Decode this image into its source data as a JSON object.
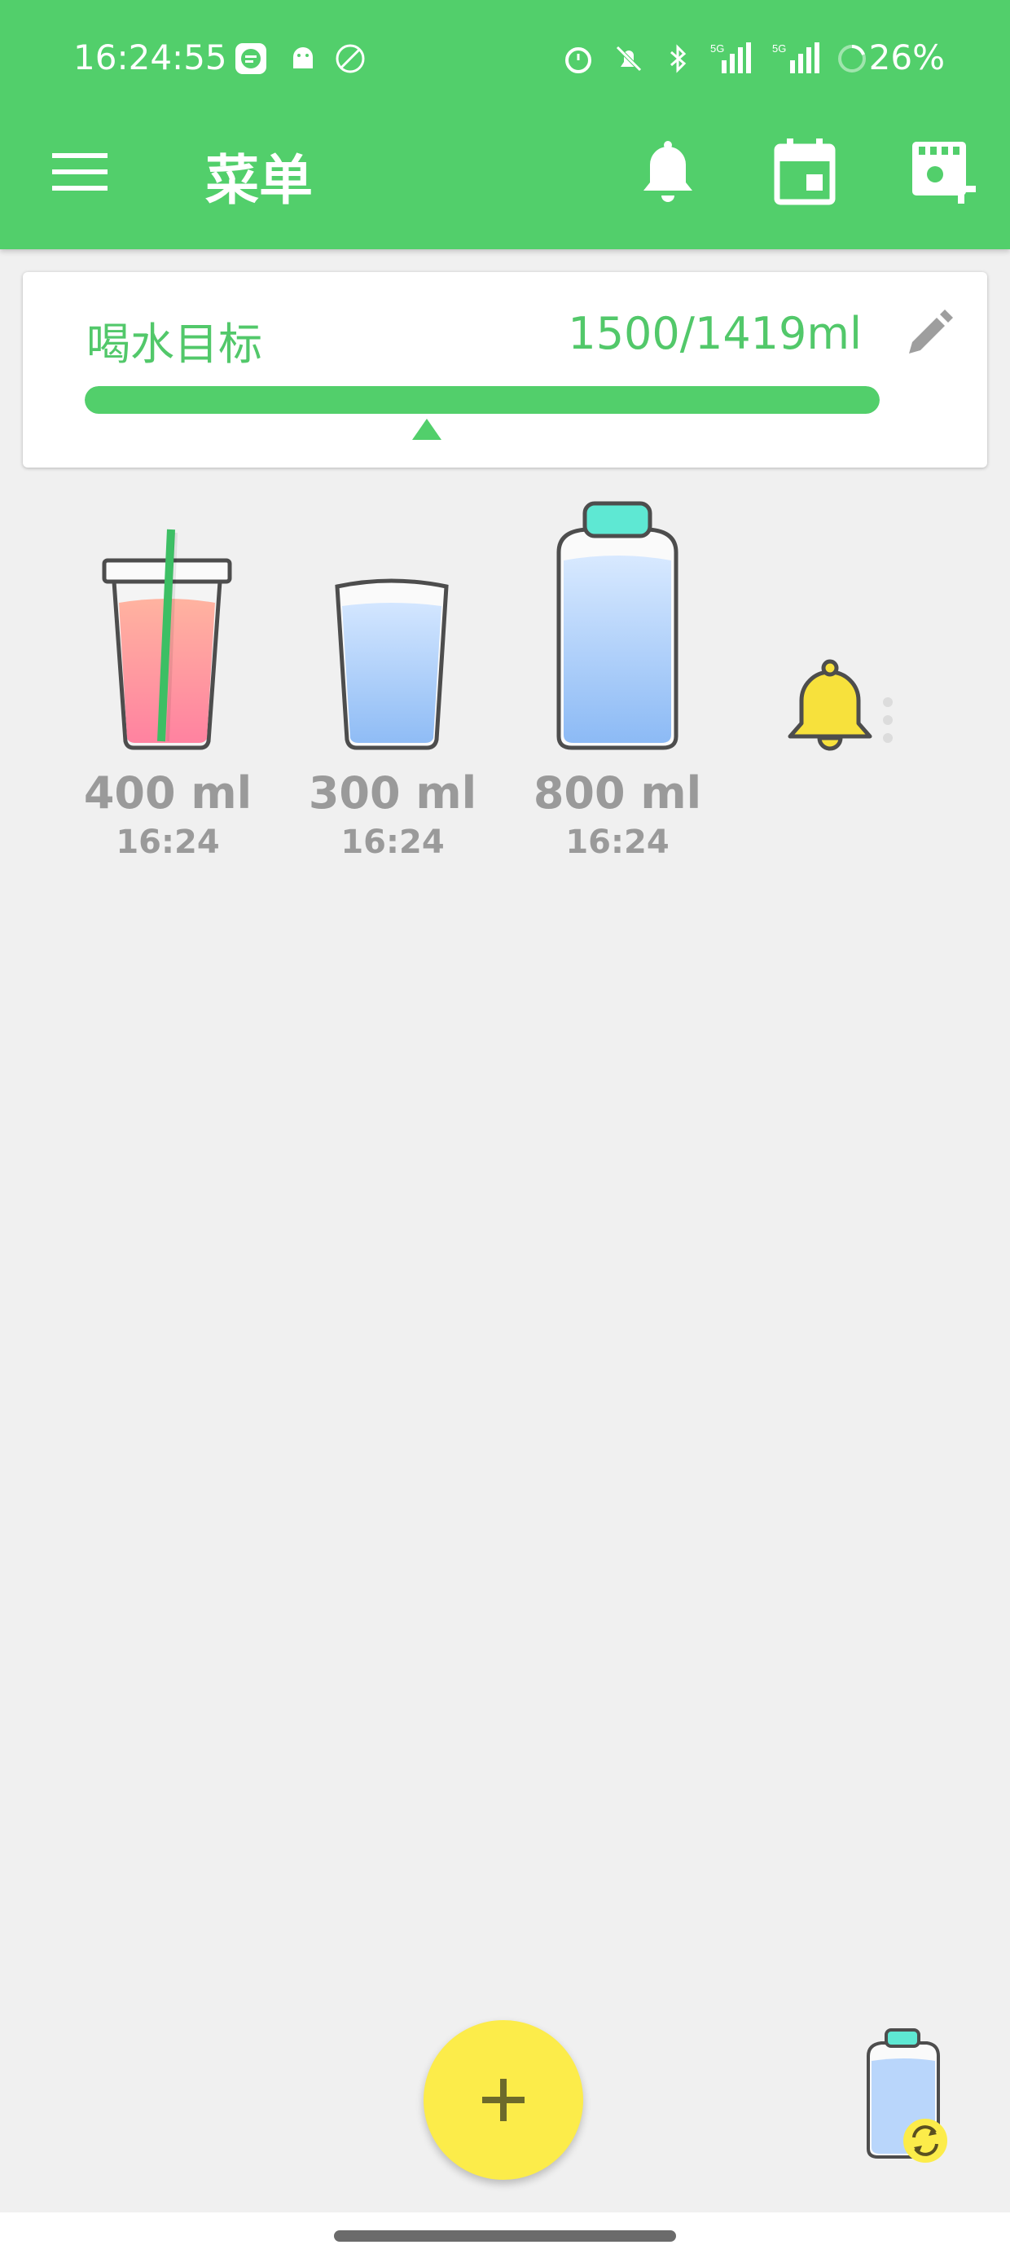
{
  "status_bar": {
    "time": "16:24:55",
    "battery": "26%",
    "signal_1": "5G",
    "signal_2": "5G"
  },
  "toolbar": {
    "title": "菜单",
    "icons": [
      "menu-icon",
      "bell-icon",
      "calendar-icon",
      "add-cup-icon"
    ]
  },
  "goal": {
    "label": "喝水目标",
    "value": "1500/1419ml",
    "progress_fraction": 1.0,
    "marker_fraction": 0.43
  },
  "entries": [
    {
      "amount": "400 ml",
      "time": "16:24",
      "icon": "pink-drink-cup-icon"
    },
    {
      "amount": "300 ml",
      "time": "16:24",
      "icon": "water-glass-icon"
    },
    {
      "amount": "800 ml",
      "time": "16:24",
      "icon": "water-bottle-icon"
    }
  ],
  "colors": {
    "primary": "#52cf6b",
    "accent": "#fcec4a",
    "text_muted": "#9a9a9a"
  }
}
